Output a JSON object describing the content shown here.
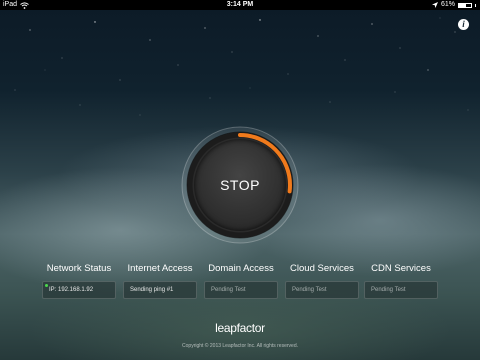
{
  "status_bar": {
    "carrier": "iPad",
    "time": "3:14 PM",
    "battery_percent": "61%",
    "battery_level": 0.61,
    "icons": [
      "wifi-icon",
      "location-arrow-icon",
      "battery-icon"
    ]
  },
  "info_button": {
    "label": "i",
    "icon": "info-icon"
  },
  "dial": {
    "button_label": "STOP",
    "progress": 0.27,
    "accent_color": "#f07a1c"
  },
  "tests": [
    {
      "label": "Network Status",
      "value": "IP: 192.168.1.92",
      "state": "done",
      "indicator_color": "#4cd84c"
    },
    {
      "label": "Internet Access",
      "value": "Sending ping #1",
      "state": "active"
    },
    {
      "label": "Domain Access",
      "value": "Pending Test",
      "state": "pending"
    },
    {
      "label": "Cloud Services",
      "value": "Pending Test",
      "state": "pending"
    },
    {
      "label": "CDN Services",
      "value": "Pending Test",
      "state": "pending"
    }
  ],
  "footer": {
    "brand": "leapfactor",
    "copyright": "Copyright © 2013 Leapfactor Inc. All rights reserved."
  }
}
